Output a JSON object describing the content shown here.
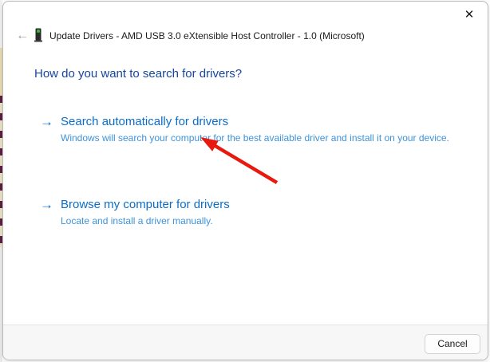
{
  "window": {
    "title": "Update Drivers - AMD USB 3.0 eXtensible Host Controller - 1.0 (Microsoft)"
  },
  "icons": {
    "close": "✕",
    "back_arrow": "←",
    "option_arrow": "→"
  },
  "content": {
    "heading": "How do you want to search for drivers?",
    "options": [
      {
        "title": "Search automatically for drivers",
        "description": "Windows will search your computer for the best available driver and install it on your device."
      },
      {
        "title": "Browse my computer for drivers",
        "description": "Locate and install a driver manually."
      }
    ]
  },
  "footer": {
    "cancel_label": "Cancel"
  },
  "annotation": {
    "description": "Red arrow pointing at the Search automatically for drivers option"
  },
  "colors": {
    "heading_blue": "#1646a0",
    "link_blue": "#0a6dc9",
    "description_blue": "#3e93dc",
    "red_arrow": "#e8190f",
    "footer_bg": "#f7f7f7"
  }
}
